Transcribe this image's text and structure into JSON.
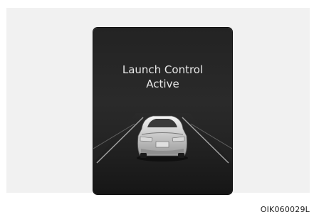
{
  "display": {
    "title_line1": "Launch Control",
    "title_line2": "Active",
    "image": "rear-car-on-road-icon"
  },
  "figure_code": "OIK060029L",
  "colors": {
    "screen_bg": "#262626",
    "text": "#e8e8e8",
    "page_bg": "#f1f1f1"
  }
}
